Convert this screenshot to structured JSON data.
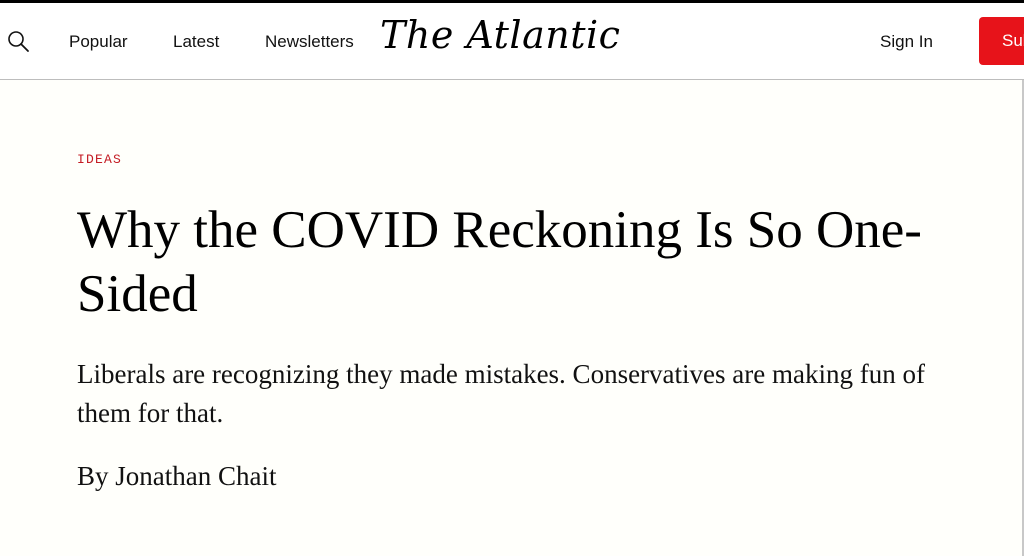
{
  "header": {
    "search_icon": "search-icon",
    "nav": {
      "popular": "Popular",
      "latest": "Latest",
      "newsletters": "Newsletters"
    },
    "logo_text": "The Atlantic",
    "sign_in": "Sign In",
    "subscribe": "Subscribe",
    "subscribe_color": "#e7131a"
  },
  "article": {
    "section": "IDEAS",
    "section_color": "#c41c24",
    "headline": "Why the COVID Reckoning Is So One-Sided",
    "dek": "Liberals are recognizing they made mistakes. Conservatives are making fun of them for that.",
    "byline_prefix": "By",
    "author": "Jonathan Chait"
  }
}
